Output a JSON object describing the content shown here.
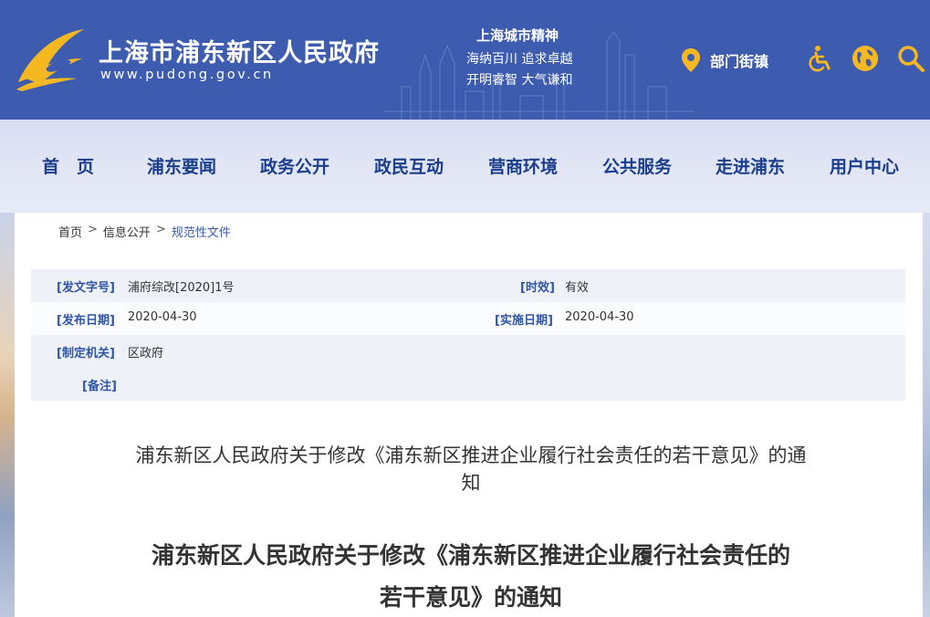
{
  "header": {
    "site_title": "上海市浦东新区人民政府",
    "site_url": "www.pudong.gov.cn",
    "spirit_title": "上海城市精神",
    "spirit_line1": "海纳百川  追求卓越",
    "spirit_line2": "开明睿智  大气谦和",
    "dept_link": "部门街镇",
    "icons": [
      "location-pin-icon",
      "accessibility-icon",
      "globe-icon",
      "search-icon"
    ],
    "colors": {
      "background": "#3d5cb0",
      "accent": "#f5b820"
    }
  },
  "nav": {
    "items": [
      "首　页",
      "浦东要闻",
      "政务公开",
      "政民互动",
      "营商环境",
      "公共服务",
      "走进浦东",
      "用户中心"
    ],
    "color": "#1a3d8c"
  },
  "breadcrumb": {
    "home": "首页",
    "sep": ">",
    "level2": "信息公开",
    "current": "规范性文件"
  },
  "meta": {
    "doc_number_label": "[发文字号]",
    "doc_number": "浦府综改[2020]1号",
    "validity_label": "[时效]",
    "validity": "有效",
    "publish_date_label": "[发布日期]",
    "publish_date": "2020-04-30",
    "effective_date_label": "[实施日期]",
    "effective_date": "2020-04-30",
    "issuer_label": "[制定机关]",
    "issuer": "区政府",
    "remark_label": "[备注]"
  },
  "document": {
    "title_line1": "浦东新区人民政府关于修改《浦东新区推进企业履行社会责任的若干意见》的通",
    "title_line2": "知",
    "heading_line1": "浦东新区人民政府关于修改《浦东新区推进企业履行社会责任的",
    "heading_line2": "若干意见》的通知"
  }
}
